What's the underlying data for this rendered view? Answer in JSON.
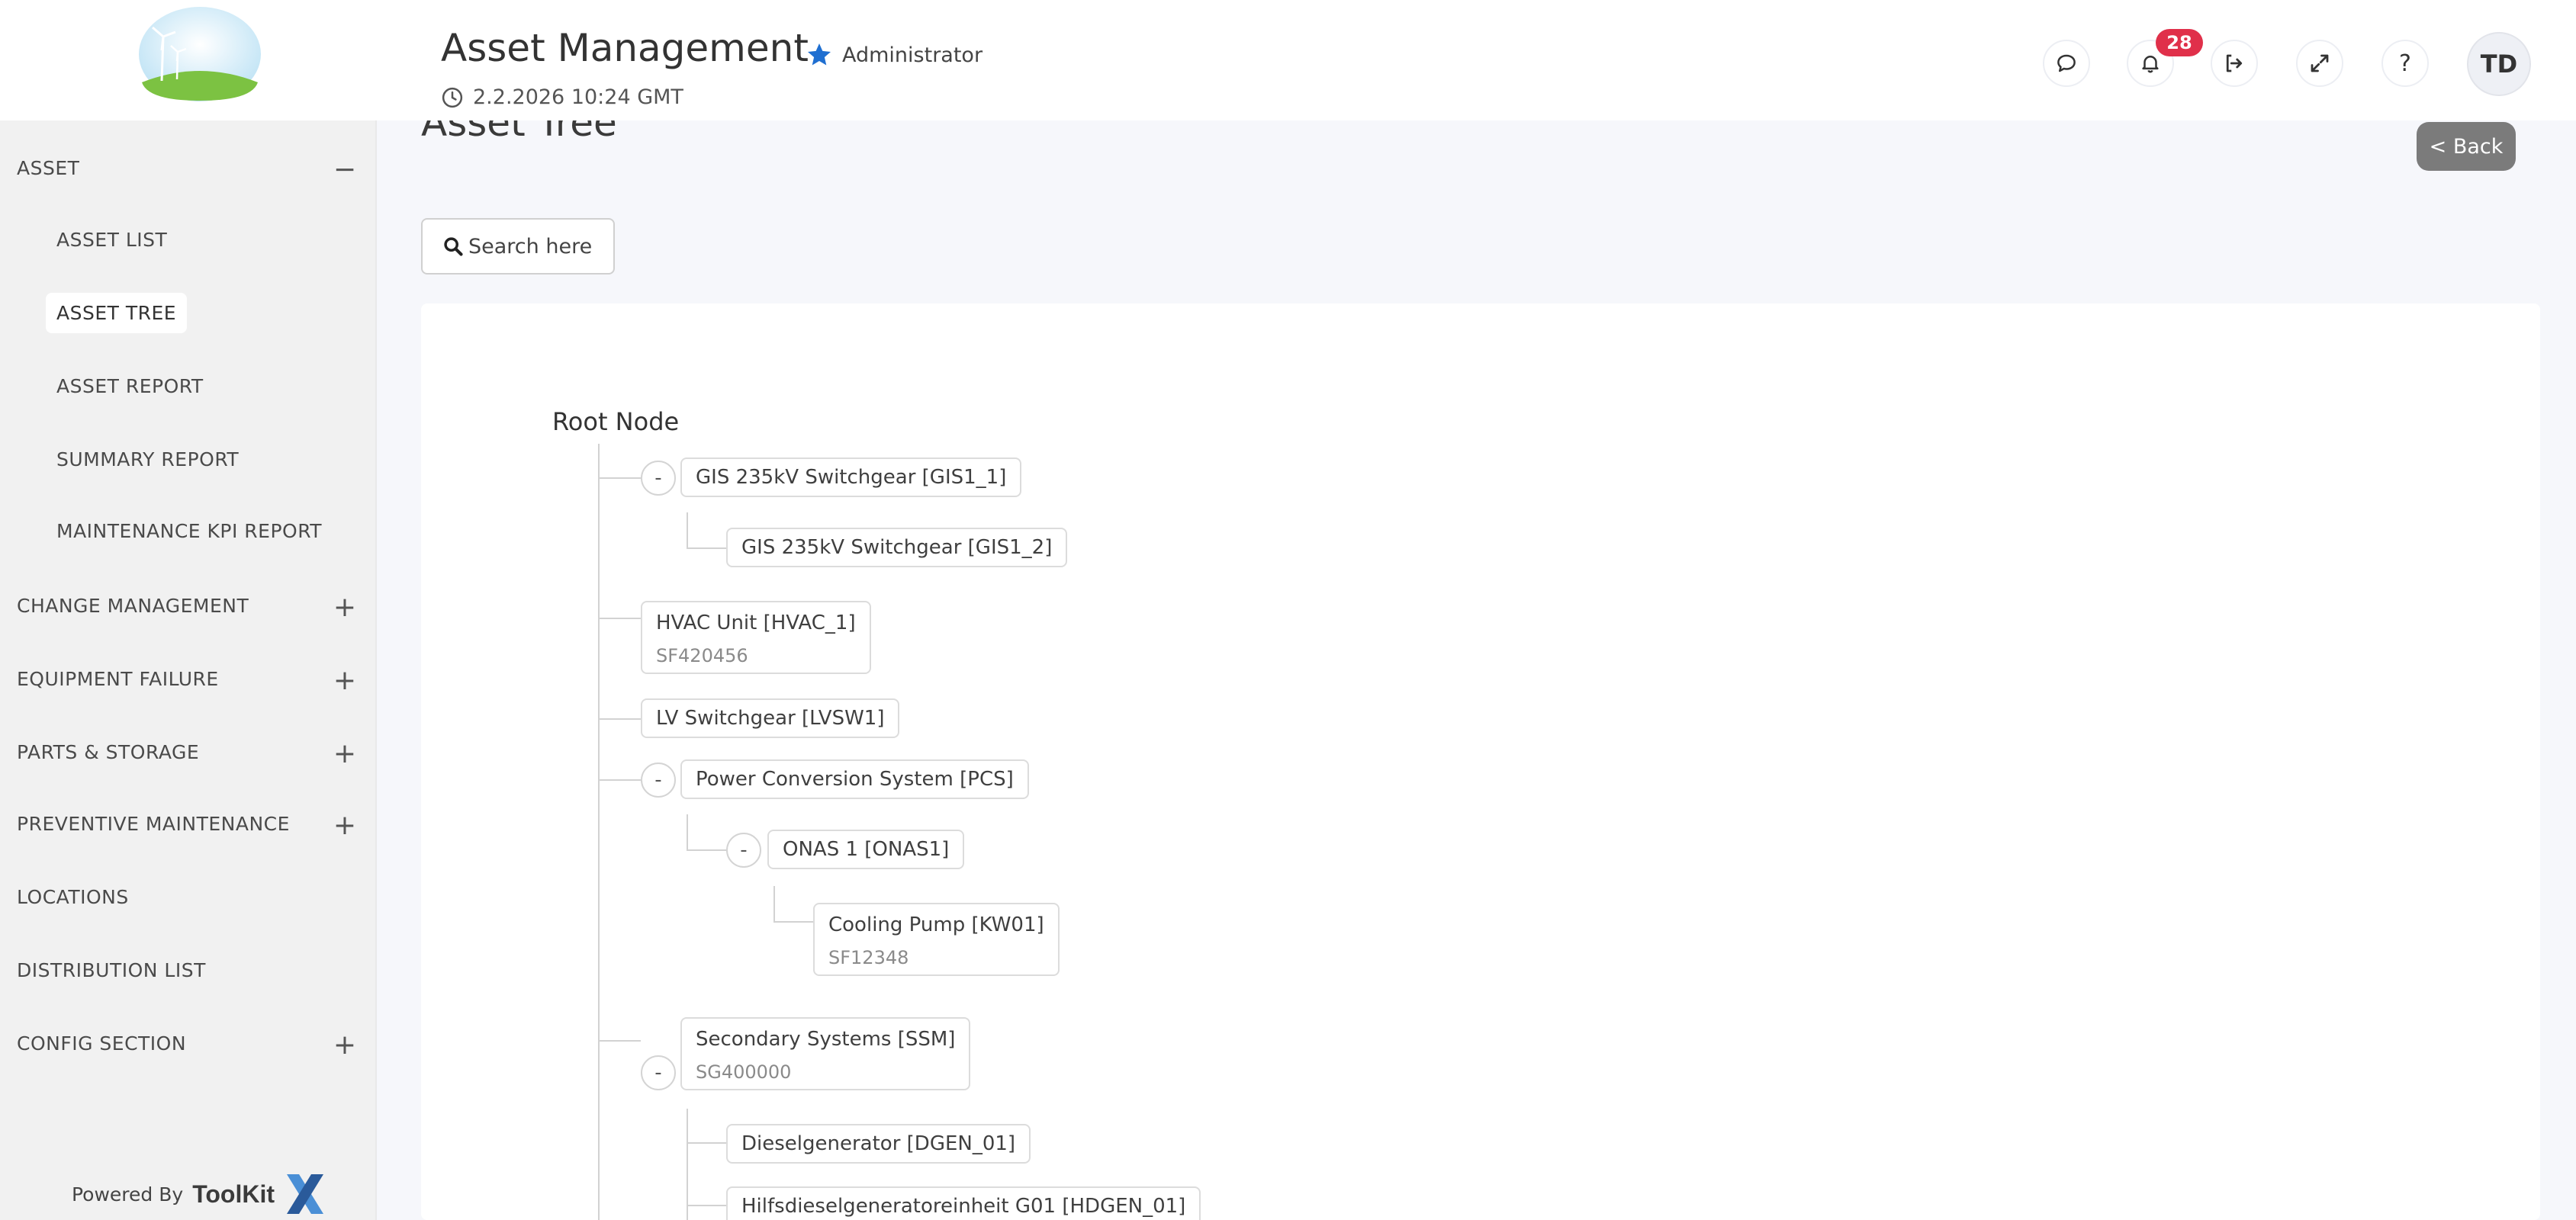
{
  "header": {
    "title": "Asset Management",
    "role": "Administrator",
    "datetime": "2.2.2026 10:24 GMT",
    "notification_count": "28",
    "avatar_initials": "TD",
    "help_label": "?"
  },
  "sidebar": {
    "items": [
      {
        "label": "ASSET",
        "toggle": "−"
      },
      {
        "label": "ASSET LIST"
      },
      {
        "label": "ASSET TREE"
      },
      {
        "label": "ASSET REPORT"
      },
      {
        "label": "SUMMARY REPORT"
      },
      {
        "label": "MAINTENANCE KPI REPORT"
      },
      {
        "label": "CHANGE MANAGEMENT",
        "toggle": "+"
      },
      {
        "label": "EQUIPMENT FAILURE",
        "toggle": "+"
      },
      {
        "label": "PARTS & STORAGE",
        "toggle": "+"
      },
      {
        "label": "PREVENTIVE MAINTENANCE",
        "toggle": "+"
      },
      {
        "label": "LOCATIONS"
      },
      {
        "label": "DISTRIBUTION LIST"
      },
      {
        "label": "CONFIG SECTION",
        "toggle": "+"
      }
    ],
    "powered_by": "Powered By",
    "brand": "ToolKit"
  },
  "main": {
    "title": "Asset Tree",
    "back_label": "< Back",
    "search_placeholder": "Search here"
  },
  "tree": {
    "root": "Root Node",
    "collapse_symbol": "-",
    "nodes": [
      {
        "label": "GIS 235kV Switchgear [GIS1_1]"
      },
      {
        "label": "GIS 235kV Switchgear [GIS1_2]"
      },
      {
        "label": "HVAC Unit [HVAC_1]",
        "sub": "SF420456"
      },
      {
        "label": "LV Switchgear [LVSW1]"
      },
      {
        "label": "Power Conversion System [PCS]"
      },
      {
        "label": "ONAS 1 [ONAS1]"
      },
      {
        "label": "Cooling Pump [KW01]",
        "sub": "SF12348"
      },
      {
        "label": "Secondary Systems [SSM]",
        "sub": "SG400000"
      },
      {
        "label": "Dieselgenerator [DGEN_01]"
      },
      {
        "label": "Hilfsdieselgeneratoreinheit G01 [HDGEN_01]"
      }
    ]
  },
  "colors": {
    "accent_star": "#1f6fd1",
    "badge": "#e0304a",
    "back_button": "#7b7b7b"
  }
}
